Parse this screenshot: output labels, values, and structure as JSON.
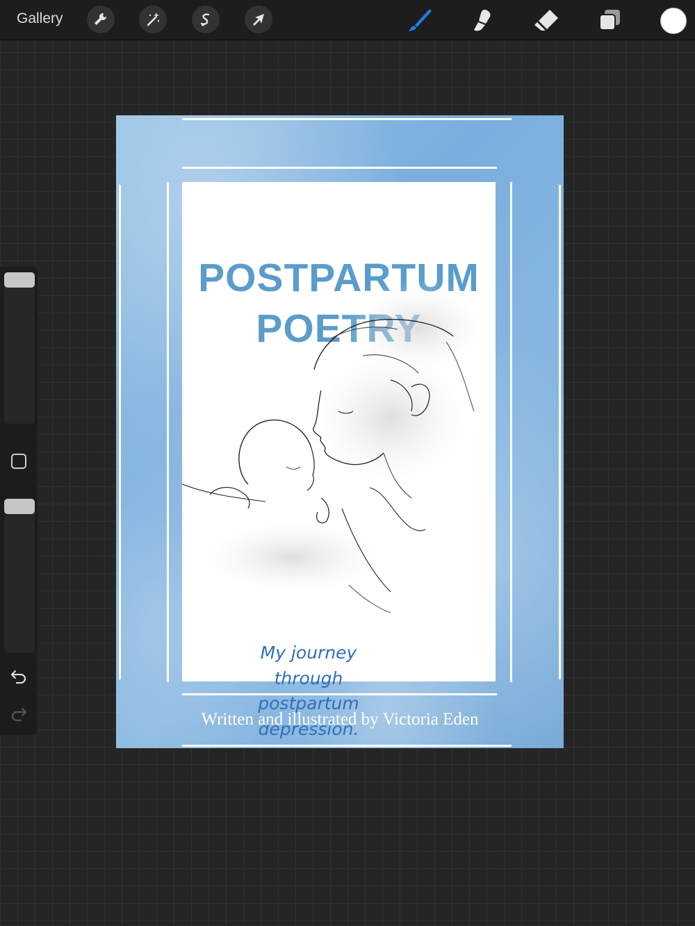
{
  "toolbar": {
    "gallery_label": "Gallery",
    "left_tools": [
      "wrench-icon",
      "magic-wand-icon",
      "selection-icon",
      "move-arrow-icon"
    ],
    "right_tools": [
      "brush-icon",
      "smudge-icon",
      "eraser-icon",
      "layers-icon"
    ],
    "active_tool": "brush-icon",
    "accent_color": "#1f7cf0",
    "current_color": "#ffffff"
  },
  "sidebar": {
    "brush_size_slider": "slider",
    "opacity_slider": "slider",
    "modify_button": "square-icon",
    "undo": "undo-icon",
    "redo": "redo-icon"
  },
  "cover": {
    "title_line1": "POSTPARTUM",
    "title_line2": "POETRY",
    "subtitle_lines": [
      "My journey",
      "through",
      "postpartum",
      "depression."
    ],
    "byline": "Written and illustrated by Victoria Eden",
    "title_color": "#5a9ccb",
    "subtitle_color": "#3070b7",
    "background_color": "#86b6e0"
  }
}
